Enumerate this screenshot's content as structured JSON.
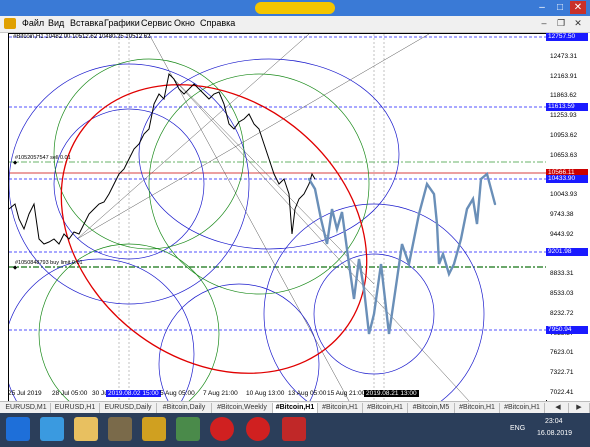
{
  "menu": {
    "items": [
      "Файл",
      "Вид",
      "Вставка",
      "Графики",
      "Сервис",
      "Окно",
      "Справка"
    ]
  },
  "chart": {
    "info_line": "#Bitcoin,H1  10482.00 10512.62 10480.25 10512.62",
    "label_sell": "#1052057547 sell 0.01",
    "label_buy": "#1050848793 buy limit 0.01"
  },
  "price_axis": {
    "ticks": [
      "12757.50",
      "12473.31",
      "12163.91",
      "11863.62",
      "11253.93",
      "10953.62",
      "10653.63",
      "10383.01",
      "10043.93",
      "9743.38",
      "9443.92",
      "9133.36",
      "8833.31",
      "8533.03",
      "8232.72",
      "7923.37",
      "7623.01",
      "7322.71",
      "7022.41"
    ],
    "tags": [
      {
        "text": "12757.50",
        "bg": "#1a1aff",
        "fg": "#ffffff"
      },
      {
        "text": "11613.59",
        "bg": "#1a1aff",
        "fg": "#ffffff"
      },
      {
        "text": "10566.11",
        "bg": "#cc0000",
        "fg": "#ffffff"
      },
      {
        "text": "10433.90",
        "bg": "#1a1aff",
        "fg": "#ffffff"
      },
      {
        "text": "9201.98",
        "bg": "#1a1aff",
        "fg": "#ffffff"
      },
      {
        "text": "7950.94",
        "bg": "#1a1aff",
        "fg": "#ffffff"
      }
    ]
  },
  "time_axis": {
    "labels": [
      "25 Jul 2019",
      "28 Jul 05:00",
      "30 Jul",
      "2019.08.02 15:00",
      "5 Aug 05:00",
      "7 Aug 21:00",
      "10 Aug 13:00",
      "13 Aug 05:00",
      "15 Aug 21:00",
      "2019.08.21 13:00"
    ]
  },
  "tabs": [
    {
      "label": "EURUSD,M1",
      "active": false
    },
    {
      "label": "EURUSD,H1",
      "active": false
    },
    {
      "label": "EURUSD,Daily",
      "active": false
    },
    {
      "label": "#Bitcoin,Daily",
      "active": false
    },
    {
      "label": "#Bitcoin,Weekly",
      "active": false
    },
    {
      "label": "#Bitcoin,H1",
      "active": true
    },
    {
      "label": "#Bitcoin,H1",
      "active": false
    },
    {
      "label": "#Bitcoin,H1",
      "active": false
    },
    {
      "label": "#Bitcoin,M5",
      "active": false
    },
    {
      "label": "#Bitcoin,H1",
      "active": false
    },
    {
      "label": "#Bitcoin,H1",
      "active": false
    }
  ],
  "taskbar": {
    "lang": "ENG",
    "time": "23:04",
    "date": "16.08.2019"
  },
  "colors": {
    "ellipse_red": "#e00000",
    "circle_blue": "#1a1acc",
    "circle_green": "#1a8a1a",
    "drawn_path": "#6a8fb8",
    "taskbar_bg": "#2b3e5a"
  }
}
